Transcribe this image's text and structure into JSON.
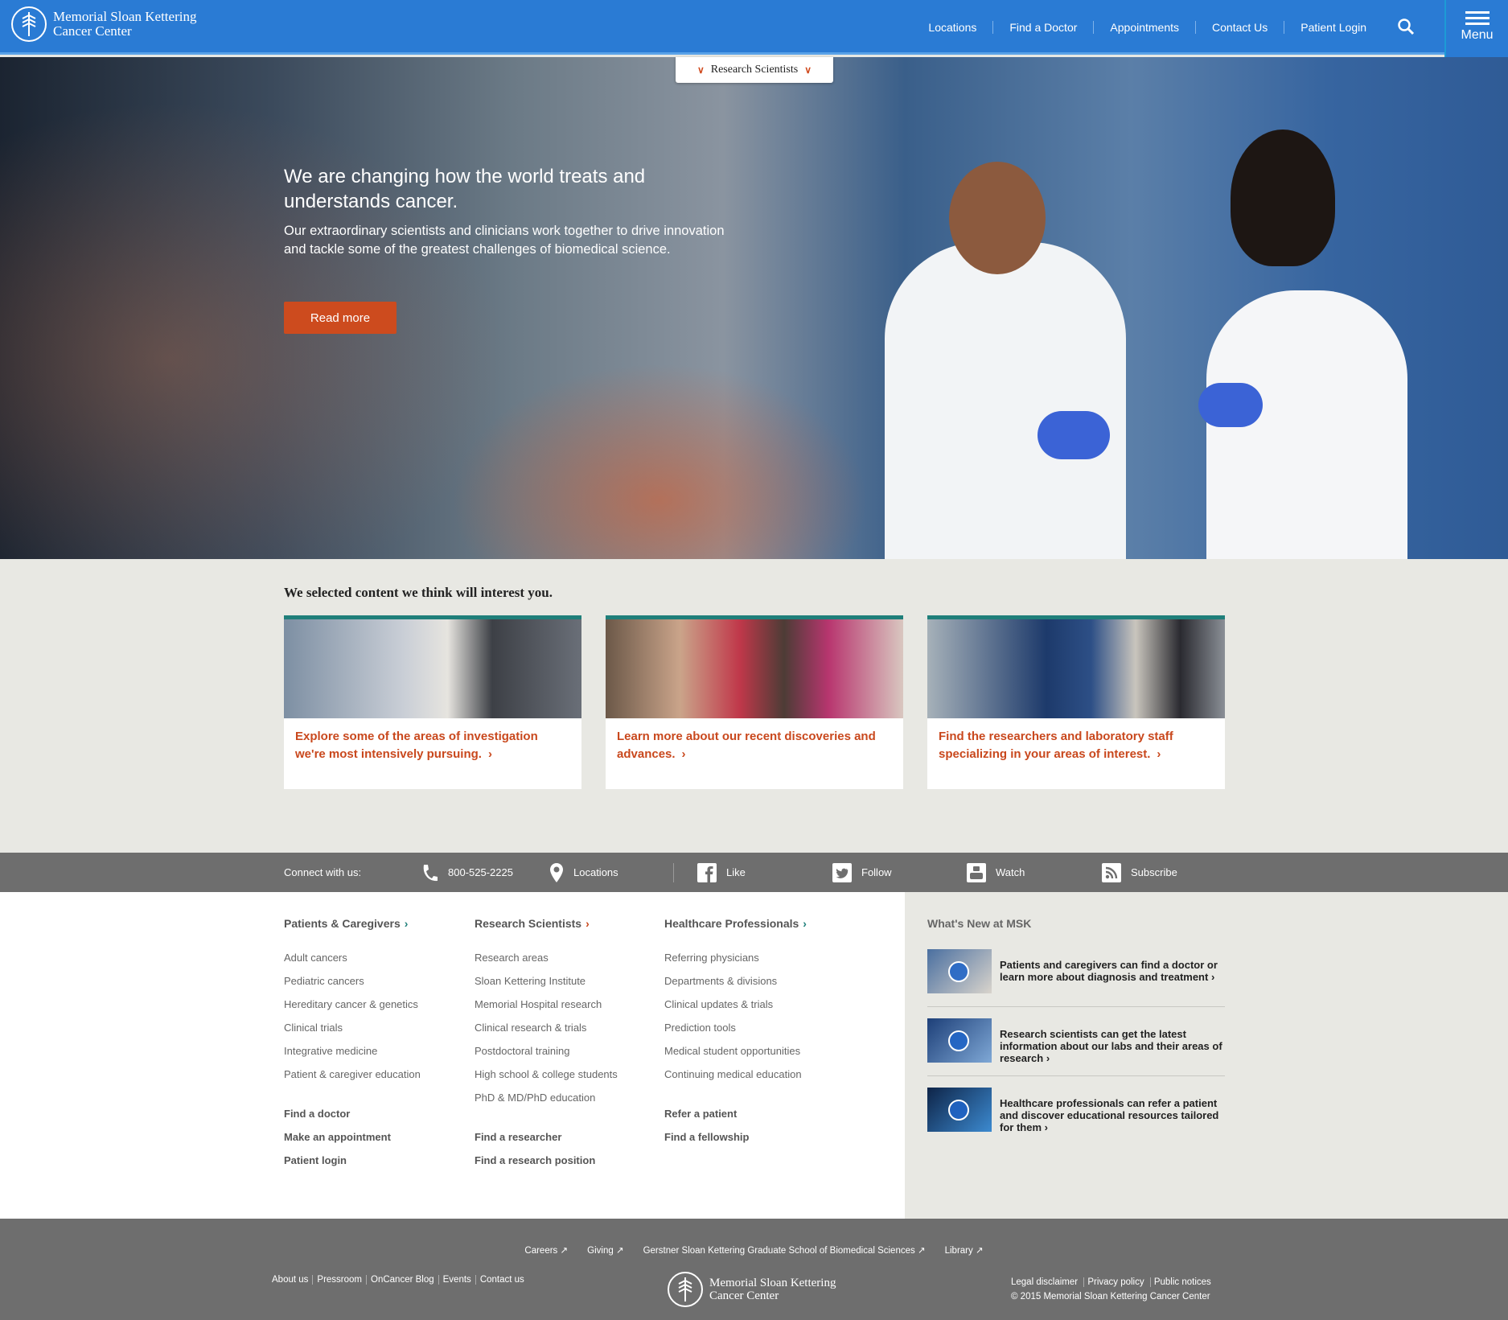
{
  "header": {
    "logo_line1": "Memorial Sloan Kettering",
    "logo_line2": "Cancer Center",
    "nav": [
      "Locations",
      "Find a Doctor",
      "Appointments",
      "Contact Us",
      "Patient Login"
    ],
    "menu_label": "Menu",
    "colors": {
      "bar": "#2a7bd4",
      "menu_border": "#1d9bd6"
    }
  },
  "hero": {
    "ribbon_label": "Research Scientists",
    "title": "We are changing how the world treats and understands cancer.",
    "subtitle": "Our extraordinary scientists and clinicians work together to drive innovation and tackle some of the greatest challenges of biomedical science.",
    "cta_label": "Read more",
    "cta_color": "#cd4b1e"
  },
  "selected": {
    "heading": "We selected content we think will interest you.",
    "cards": [
      {
        "text": "Explore some of the areas of investigation we're most intensively pursuing."
      },
      {
        "text": "Learn more about our recent discoveries and advances."
      },
      {
        "text": "Find the researchers and laboratory staff specializing in your areas of interest."
      }
    ]
  },
  "connect": {
    "label": "Connect with us:",
    "phone": "800-525-2225",
    "locations": "Locations",
    "like": "Like",
    "follow": "Follow",
    "watch": "Watch",
    "subscribe": "Subscribe"
  },
  "footer": {
    "columns": [
      {
        "title": "Patients & Caregivers",
        "links": [
          "Adult cancers",
          "Pediatric cancers",
          "Hereditary cancer & genetics",
          "Clinical trials",
          "Integrative medicine",
          "Patient & caregiver education"
        ],
        "actions": [
          "Find a doctor",
          "Make an appointment",
          "Patient login"
        ]
      },
      {
        "title": "Research Scientists",
        "links": [
          "Research areas",
          "Sloan Kettering Institute",
          "Memorial Hospital research",
          "Clinical research & trials",
          "Postdoctoral training",
          "High school & college students",
          "PhD & MD/PhD education"
        ],
        "actions": [
          "Find a researcher",
          "Find a research position"
        ]
      },
      {
        "title": "Healthcare Professionals",
        "links": [
          "Referring physicians",
          "Departments & divisions",
          "Clinical updates & trials",
          "Prediction tools",
          "Medical student opportunities",
          "Continuing medical education"
        ],
        "actions": [
          "Refer a patient",
          "Find a fellowship"
        ]
      }
    ],
    "news_title": "What's New at MSK",
    "news": [
      {
        "text": "Patients and caregivers can find a doctor or learn more about diagnosis and treatment"
      },
      {
        "text": "Research scientists can get the latest information about our labs and their areas of research"
      },
      {
        "text": "Healthcare professionals can refer a patient and discover educational resources tailored for them"
      }
    ]
  },
  "bottom": {
    "top_links": [
      "Careers",
      "Giving",
      "Gerstner Sloan Kettering Graduate School of Biomedical Sciences",
      "Library"
    ],
    "left_links": [
      "About us",
      "Pressroom",
      "OnCancer Blog",
      "Events",
      "Contact us"
    ],
    "logo_line1": "Memorial Sloan Kettering",
    "logo_line2": "Cancer Center",
    "right_links": [
      "Legal disclaimer",
      "Privacy policy",
      "Public notices"
    ],
    "copyright": "© 2015 Memorial Sloan Kettering Cancer Center"
  }
}
